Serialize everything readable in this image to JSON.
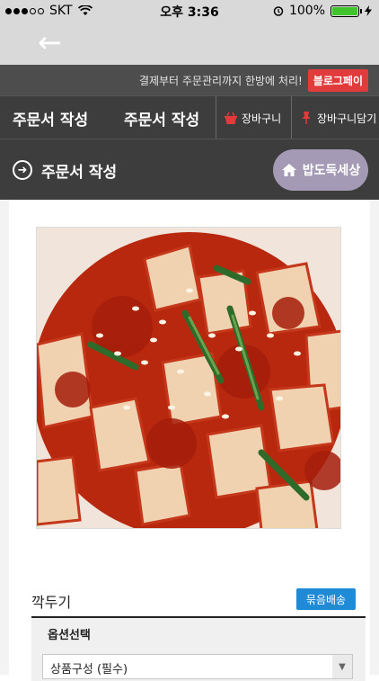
{
  "status_bar": {
    "carrier": "SKT",
    "time": "오후 3:36",
    "battery": "100%",
    "battery_level": 1.0
  },
  "promo": {
    "text": "결제부터 주문관리까지 한방에 처리!",
    "button": "블로그페이"
  },
  "tabs": {
    "title_left": "주문서 작성",
    "title_right": "주문서 작성",
    "cart": "장바구니",
    "add_to_cart": "장바구니담기"
  },
  "section": {
    "title": "주문서 작성",
    "home_button": "밥도둑세상"
  },
  "product": {
    "name": "깍두기",
    "bundle_button": "묶음배송"
  },
  "options": {
    "title": "옵션선택",
    "select_value": "상품구성 (필수)"
  },
  "colors": {
    "promo_button": "#e23b3b",
    "bundle_button": "#1f8ad6",
    "home_button": "#a49ab5",
    "header_dark": "#3d3d3d"
  }
}
